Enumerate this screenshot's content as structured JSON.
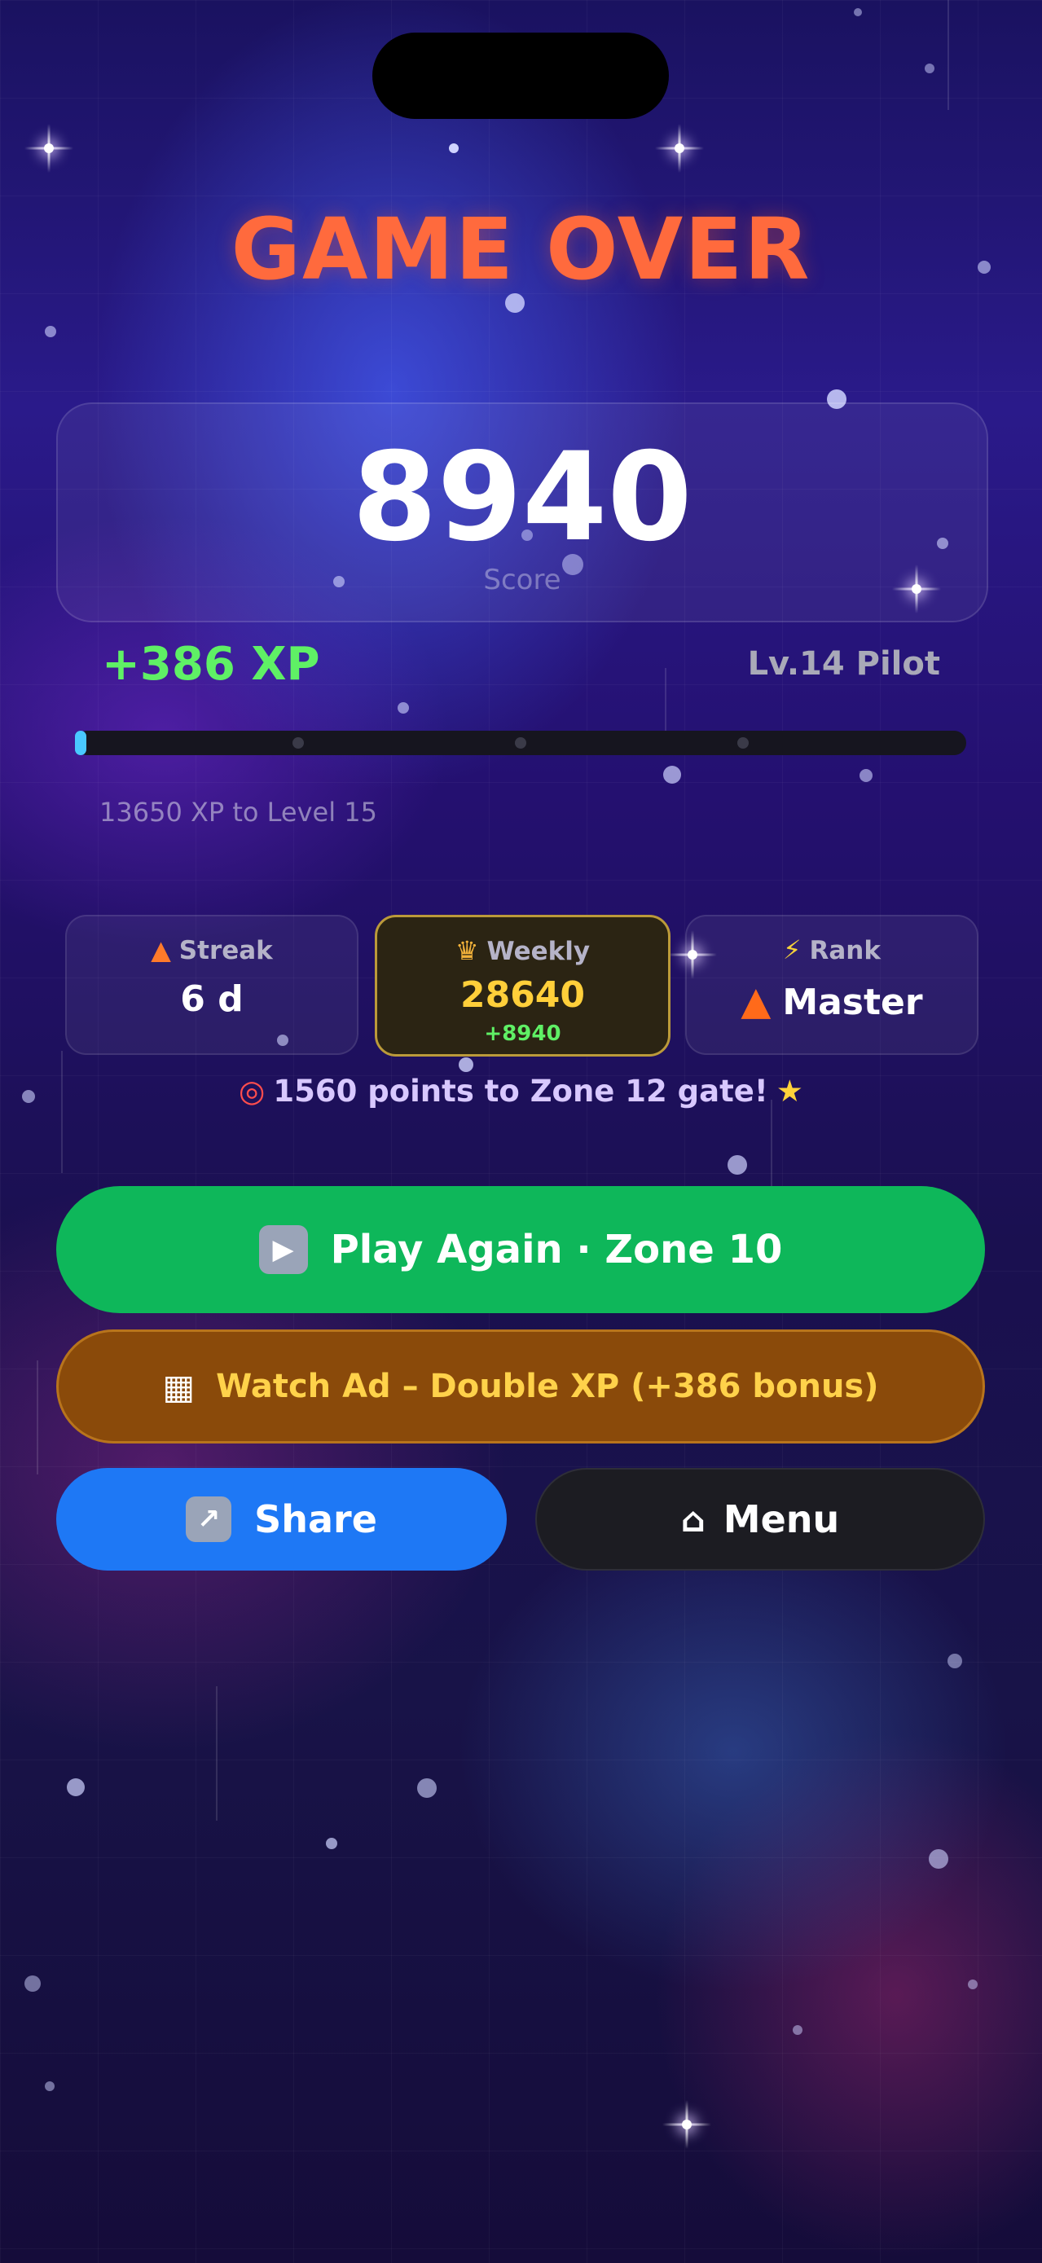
{
  "screen": {
    "title": "GAME OVER",
    "score": "8940",
    "score_label": "Score"
  },
  "progress": {
    "xp_gain": "+386 XP",
    "level": "Lv.14  Pilot",
    "fill_fraction": 0.012,
    "xp_to_next": "13650 XP to Level 15"
  },
  "stats": {
    "streak": {
      "label": "Streak",
      "value": "6 d",
      "icon": "fire-icon"
    },
    "weekly": {
      "label": "Weekly",
      "value": "28640",
      "delta": "+8940",
      "icon": "trophy-icon"
    },
    "rank": {
      "label": "Rank",
      "value": "Master",
      "icon": "lightning-icon",
      "badge_icon": "fire-icon"
    }
  },
  "zone_message": "1560 points to Zone 12 gate!",
  "buttons": {
    "play_again": "Play Again · Zone 10",
    "watch_ad": "Watch Ad – Double XP (+386 bonus)",
    "share": "Share",
    "menu": "Menu"
  },
  "colors": {
    "title": "#ff6a3d",
    "xp_gain": "#5ff065",
    "play_button": "#0eb75a",
    "watch_button": "#8a4a0a",
    "share_button": "#1e78f5",
    "menu_button": "#1c1c22",
    "weekly_value": "#ffcf3a"
  }
}
